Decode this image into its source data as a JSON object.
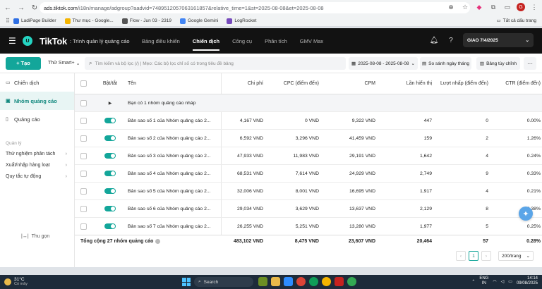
{
  "browser": {
    "url_host": "ads.tiktok.com",
    "url_path": "/i18n/manage/adgroup?aadvid=7489512057063161857&relative_time=1&st=2025-08-08&et=2025-08-08",
    "profile_initial": "G"
  },
  "bookmarks": {
    "items": [
      {
        "label": "LadiPage Builder",
        "color": "#2f6fe4"
      },
      {
        "label": "Thư mục - Google...",
        "color": "#f4b400"
      },
      {
        "label": "Flow - Jun 03 - 2319",
        "color": "#555555"
      },
      {
        "label": "Google Gemini",
        "color": "#4285f4"
      },
      {
        "label": "LogRocket",
        "color": "#764abc"
      }
    ],
    "all_bookmarks": "Tất cả dấu trang"
  },
  "header": {
    "logo": "TikTok",
    "app_name": ": Trình quản lý quảng cáo",
    "account_initial": "U",
    "nav": [
      "Bảng điều khiển",
      "Chiến dịch",
      "Công cụ",
      "Phân tích",
      "GMV Max"
    ],
    "active_nav": "Chiến dịch",
    "account_name": "GIAO 7/4/2025"
  },
  "toolbar": {
    "create_label": "+ Tạo",
    "smart_label": "Thử Smart+",
    "search_placeholder": "Tìm kiếm và bộ lọc (/) | Mẹo: Các bộ lọc chỉ số có trong tiêu đề bảng",
    "date_range": "2025-08-08 - 2025-08-08",
    "compare_label": "So sánh ngày tháng",
    "custom_label": "Bảng tùy chỉnh"
  },
  "sidebar": {
    "items": [
      {
        "label": "Chiến dịch",
        "active": false
      },
      {
        "label": "Nhóm quảng cáo",
        "active": true
      },
      {
        "label": "Quảng cáo",
        "active": false
      }
    ],
    "section_title": "Quản lý",
    "sub_items": [
      "Thử nghiệm phân tách",
      "Xuất/nhập hàng loạt",
      "Quy tắc tự động"
    ],
    "collapse_label": "Thu gọn"
  },
  "table": {
    "headers": {
      "onoff": "Bật/tắt",
      "name": "Tên",
      "cost": "Chi phí",
      "cpc": "CPC (điểm đến)",
      "cpm": "CPM",
      "impressions": "Lần hiển thị",
      "conversions": "Lượt nhấp (điểm đến)",
      "ctr": "CTR (điểm đến)"
    },
    "draft_row": "Bạn có 1 nhóm quảng cáo nháp",
    "rows": [
      {
        "name": "Bản sao số 1 của Nhóm quảng cáo 2...",
        "cost": "4,167 VND",
        "cpc": "0 VND",
        "cpm": "9,322 VND",
        "impressions": "447",
        "conversions": "0",
        "ctr": "0.00%"
      },
      {
        "name": "Bản sao số 2 của Nhóm quảng cáo 2...",
        "cost": "6,592 VND",
        "cpc": "3,296 VND",
        "cpm": "41,459 VND",
        "impressions": "159",
        "conversions": "2",
        "ctr": "1.26%"
      },
      {
        "name": "Bản sao số 3 của Nhóm quảng cáo 2...",
        "cost": "47,933 VND",
        "cpc": "11,983 VND",
        "cpm": "29,191 VND",
        "impressions": "1,642",
        "conversions": "4",
        "ctr": "0.24%"
      },
      {
        "name": "Bản sao số 4 của Nhóm quảng cáo 2...",
        "cost": "68,531 VND",
        "cpc": "7,614 VND",
        "cpm": "24,929 VND",
        "impressions": "2,749",
        "conversions": "9",
        "ctr": "0.33%"
      },
      {
        "name": "Bản sao số 5 của Nhóm quảng cáo 2...",
        "cost": "32,006 VND",
        "cpc": "8,001 VND",
        "cpm": "16,695 VND",
        "impressions": "1,917",
        "conversions": "4",
        "ctr": "0.21%"
      },
      {
        "name": "Bản sao số 6 của Nhóm quảng cáo 2...",
        "cost": "29,034 VND",
        "cpc": "3,629 VND",
        "cpm": "13,637 VND",
        "impressions": "2,129",
        "conversions": "8",
        "ctr": "0.38%"
      },
      {
        "name": "Bản sao số 7 của Nhóm quảng cáo 2...",
        "cost": "26,255 VND",
        "cpc": "5,251 VND",
        "cpm": "13,280 VND",
        "impressions": "1,977",
        "conversions": "5",
        "ctr": "0.25%"
      }
    ],
    "total": {
      "label": "Tổng cộng 27 nhóm quảng cáo",
      "cost": "483,102 VND",
      "cpc": "8,475 VND",
      "cpm": "23,607 VND",
      "impressions": "20,464",
      "conversions": "57",
      "ctr": "0.28%"
    }
  },
  "pagination": {
    "current_page": "1",
    "per_page": "200/trang"
  },
  "taskbar": {
    "temp": "31°C",
    "weather_desc": "Có mây",
    "search_label": "Search",
    "lang_top": "ENG",
    "lang_bottom": "IN",
    "time": "14:14",
    "date": "09/08/2025"
  }
}
